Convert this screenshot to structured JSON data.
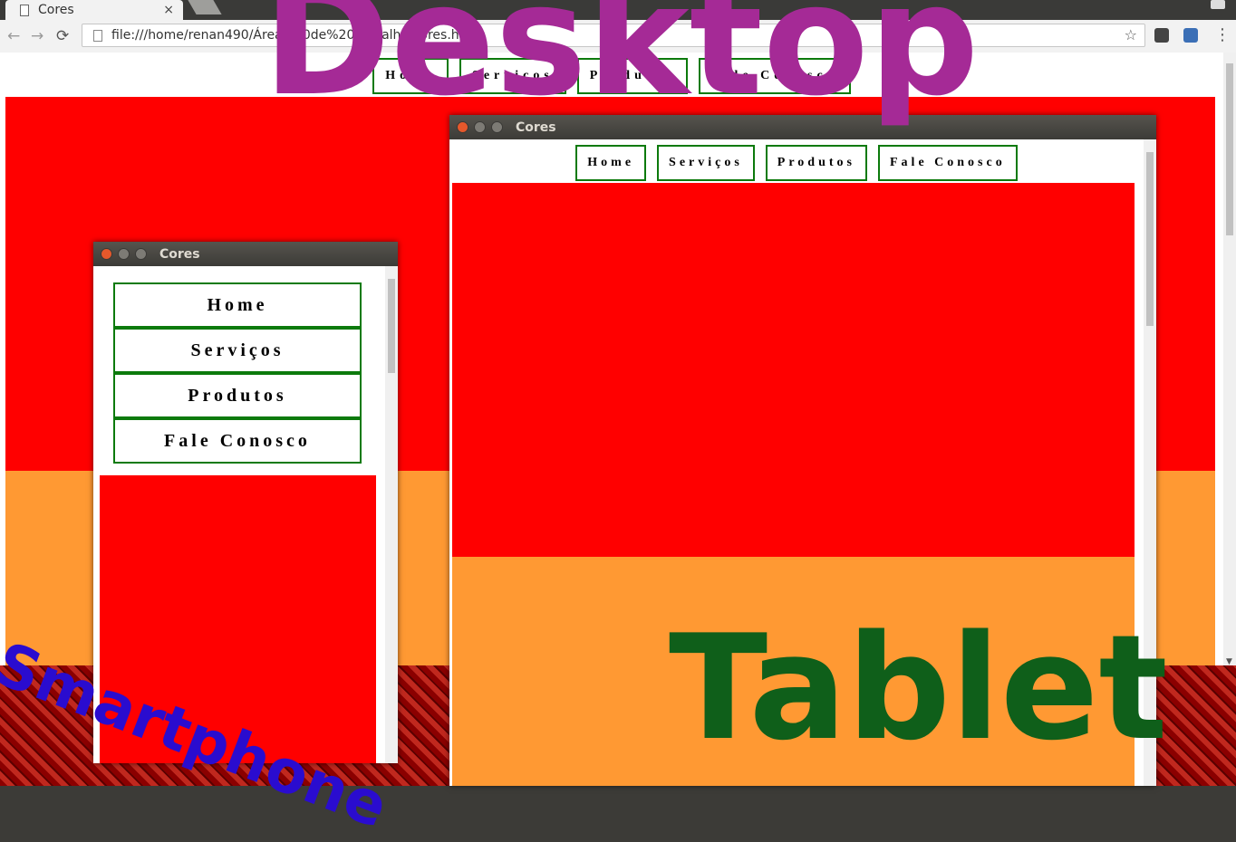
{
  "browser": {
    "tab_title": "Cores",
    "tab_close": "×",
    "url": "file:///home/renan490/Área%20de%20Trabalho/cores.html",
    "back": "←",
    "forward": "→",
    "reload": "⟳",
    "star": "☆",
    "menu": "⋮"
  },
  "desktop": {
    "nav": [
      "Home",
      "Serviços",
      "Produtos",
      "Fale Conosco"
    ]
  },
  "smartphone_window": {
    "title": "Cores",
    "nav": [
      "Home",
      "Serviços",
      "Produtos",
      "Fale Conosco"
    ]
  },
  "tablet_window": {
    "title": "Cores",
    "nav": [
      "Home",
      "Serviços",
      "Produtos",
      "Fale Conosco"
    ]
  },
  "labels": {
    "desktop": "Desktop",
    "tablet": "Tablet",
    "smartphone": "Smartphone"
  },
  "colors": {
    "red_section": "#ff0000",
    "orange_section": "#ff9933",
    "nav_border": "#0c7a0c",
    "desktop_label": "#a52a96",
    "tablet_label": "#0f5f1a",
    "smartphone_label": "#2a0ccf"
  }
}
